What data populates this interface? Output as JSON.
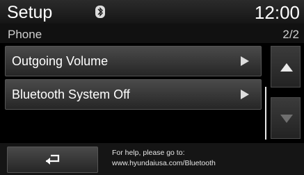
{
  "header": {
    "title": "Setup",
    "time": "12:00",
    "bluetooth_icon": "bluetooth-icon"
  },
  "subheader": {
    "section": "Phone",
    "page_indicator": "2/2"
  },
  "menu": {
    "items": [
      {
        "label": "Outgoing Volume",
        "icon": "play-arrow-icon"
      },
      {
        "label": "Bluetooth System Off",
        "icon": "play-arrow-icon"
      }
    ]
  },
  "scroll": {
    "up_icon": "triangle-up-icon",
    "down_icon": "triangle-down-icon"
  },
  "footer": {
    "back_icon": "return-arrow-icon",
    "help_line1": "For help, please go to:",
    "help_line2": "www.hyundaiusa.com/Bluetooth"
  }
}
